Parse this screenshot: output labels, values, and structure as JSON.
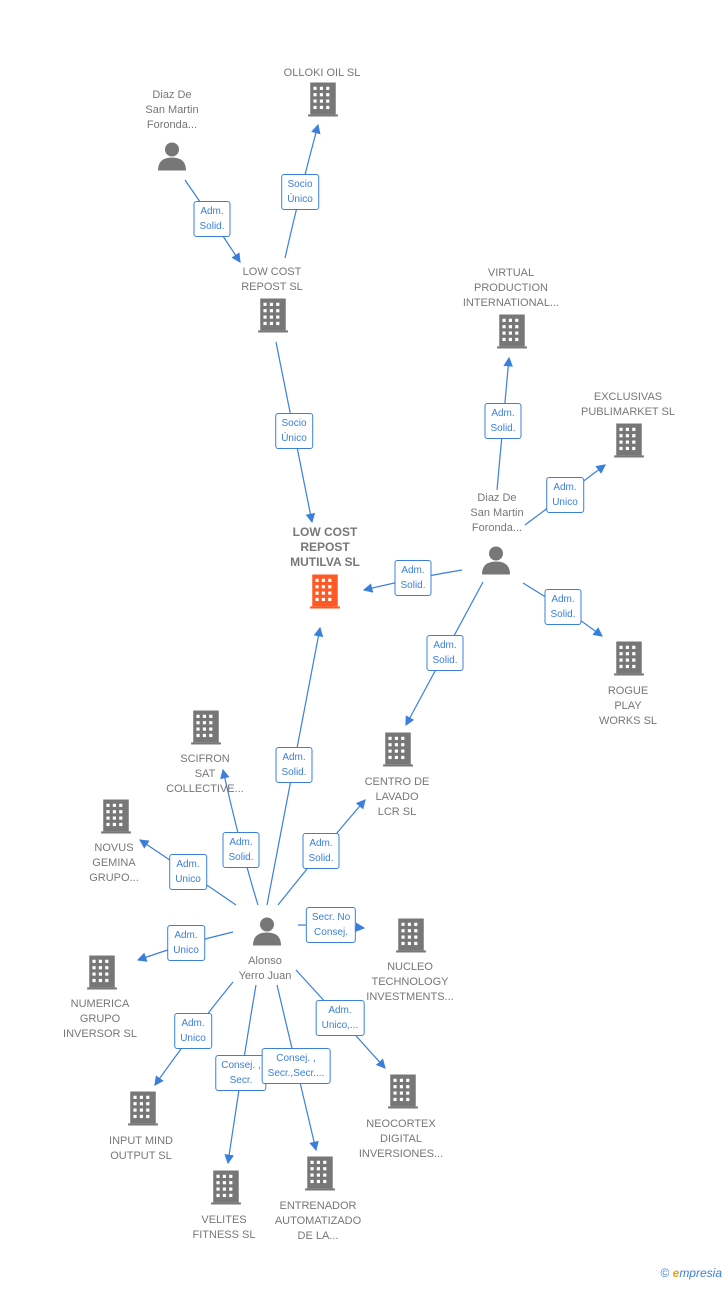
{
  "colors": {
    "edge": "#3a7fdc",
    "node": "#777777",
    "focus": "#ff5a26"
  },
  "nodes": {
    "olloki": {
      "label": [
        "OLLOKI OIL  SL"
      ],
      "icon": "building-icon"
    },
    "diaz1": {
      "label": [
        "Diaz De",
        "San Martin",
        "Foronda..."
      ],
      "icon": "person-icon"
    },
    "lowcost": {
      "label": [
        "LOW COST",
        "REPOST  SL"
      ],
      "icon": "building-icon"
    },
    "virtual": {
      "label": [
        "VIRTUAL",
        "PRODUCTION",
        "INTERNATIONAL..."
      ],
      "icon": "building-icon"
    },
    "exclusivas": {
      "label": [
        "EXCLUSIVAS",
        "PUBLIMARKET SL"
      ],
      "icon": "building-icon"
    },
    "diaz2": {
      "label": [
        "Diaz De",
        "San Martin",
        "Foronda..."
      ],
      "icon": "person-icon"
    },
    "main": {
      "label": [
        "LOW COST",
        "REPOST",
        "MUTILVA  SL"
      ],
      "icon": "building-icon"
    },
    "rogue": {
      "label": [
        "ROGUE",
        "PLAY",
        "WORKS  SL"
      ],
      "icon": "building-icon"
    },
    "scifron": {
      "label": [
        "SCIFRON",
        "SAT",
        "COLLECTIVE..."
      ],
      "icon": "building-icon"
    },
    "centro": {
      "label": [
        "CENTRO DE",
        "LAVADO",
        "LCR  SL"
      ],
      "icon": "building-icon"
    },
    "novus": {
      "label": [
        "NOVUS",
        "GEMINA",
        "GRUPO..."
      ],
      "icon": "building-icon"
    },
    "alonso": {
      "label": [
        "Alonso",
        "Yerro Juan"
      ],
      "icon": "person-icon"
    },
    "nucleo": {
      "label": [
        "NUCLEO",
        "TECHNOLOGY",
        "INVESTMENTS..."
      ],
      "icon": "building-icon"
    },
    "numerica": {
      "label": [
        "NUMERICA",
        "GRUPO",
        "INVERSOR SL"
      ],
      "icon": "building-icon"
    },
    "input": {
      "label": [
        "INPUT MIND",
        "OUTPUT  SL"
      ],
      "icon": "building-icon"
    },
    "neocortex": {
      "label": [
        "NEOCORTEX",
        "DIGITAL",
        "INVERSIONES..."
      ],
      "icon": "building-icon"
    },
    "velites": {
      "label": [
        "VELITES",
        "FITNESS  SL"
      ],
      "icon": "building-icon"
    },
    "entrenador": {
      "label": [
        "ENTRENADOR",
        "AUTOMATIZADO",
        "DE LA..."
      ],
      "icon": "building-icon"
    }
  },
  "edges": [
    {
      "from": "diaz1",
      "to": "lowcost",
      "label": [
        "Adm.",
        "Solid."
      ]
    },
    {
      "from": "lowcost",
      "to": "olloki",
      "label": [
        "Socio",
        "Único"
      ]
    },
    {
      "from": "lowcost",
      "to": "main",
      "label": [
        "Socio",
        "Único"
      ]
    },
    {
      "from": "diaz2",
      "to": "virtual",
      "label": [
        "Adm.",
        "Solid."
      ]
    },
    {
      "from": "diaz2",
      "to": "exclusivas",
      "label": [
        "Adm.",
        "Unico"
      ]
    },
    {
      "from": "diaz2",
      "to": "main",
      "label": [
        "Adm.",
        "Solid."
      ]
    },
    {
      "from": "diaz2",
      "to": "rogue",
      "label": [
        "Adm.",
        "Solid."
      ]
    },
    {
      "from": "diaz2",
      "to": "centro",
      "label": [
        "Adm.",
        "Solid."
      ]
    },
    {
      "from": "alonso",
      "to": "main",
      "label": [
        "Adm.",
        "Solid."
      ]
    },
    {
      "from": "alonso",
      "to": "scifron",
      "label": [
        "Adm.",
        "Solid."
      ]
    },
    {
      "from": "alonso",
      "to": "centro",
      "label": [
        "Adm.",
        "Solid."
      ]
    },
    {
      "from": "alonso",
      "to": "novus",
      "label": [
        "Adm.",
        "Unico"
      ]
    },
    {
      "from": "alonso",
      "to": "nucleo",
      "label": [
        "Secr.  No",
        "Consej."
      ]
    },
    {
      "from": "alonso",
      "to": "numerica",
      "label": [
        "Adm.",
        "Unico"
      ]
    },
    {
      "from": "alonso",
      "to": "input",
      "label": [
        "Adm.",
        "Unico"
      ]
    },
    {
      "from": "alonso",
      "to": "velites",
      "label": [
        "Consej. ,",
        "Secr."
      ]
    },
    {
      "from": "alonso",
      "to": "entrenador",
      "label": [
        "Consej. ,",
        "Secr.,Secr...."
      ]
    },
    {
      "from": "alonso",
      "to": "neocortex",
      "label": [
        "Adm.",
        "Unico,..."
      ]
    }
  ],
  "footer": {
    "copyright": "©",
    "brand_initial": "e",
    "brand_rest": "mpresia"
  }
}
